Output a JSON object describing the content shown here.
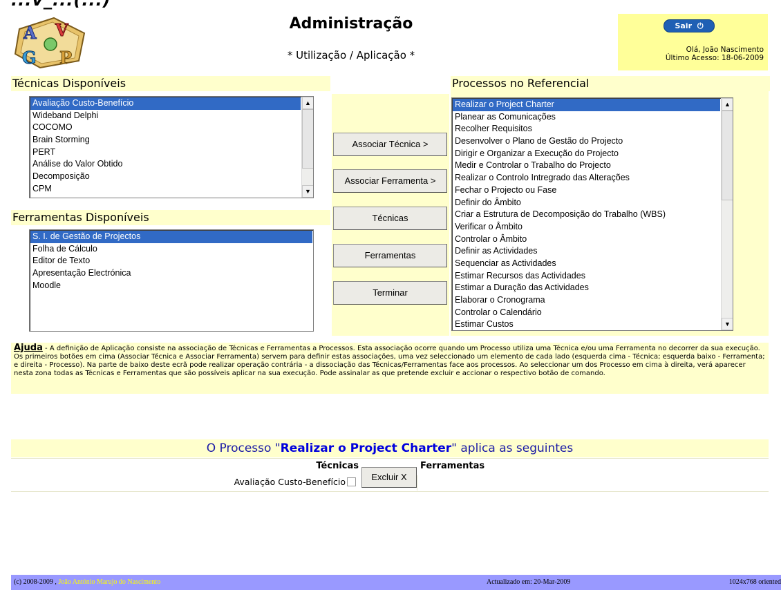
{
  "page": {
    "cut_heading": "...v_...(...)",
    "title": "Administração",
    "subtitle": "* Utilização / Aplicação *"
  },
  "user": {
    "logout_label": "Sair",
    "greeting": "Olá, João Nascimento",
    "last_access": "Último Acesso: 18-06-2009"
  },
  "techniques": {
    "heading": "Técnicas Disponíveis",
    "items": [
      "Avaliação Custo-Benefício",
      "Wideband Delphi",
      "COCOMO",
      "Brain Storming",
      "PERT",
      "Análise do Valor Obtido",
      "Decomposição",
      "CPM"
    ],
    "selected_index": 0
  },
  "tools": {
    "heading": "Ferramentas Disponíveis",
    "items": [
      "S. I. de Gestão de Projectos",
      "Folha de Cálculo",
      "Editor de Texto",
      "Apresentação Electrónica",
      "Moodle"
    ],
    "selected_index": 0
  },
  "actions": {
    "assoc_technique": "Associar Técnica >",
    "assoc_tool": "Associar Ferramenta >",
    "techniques": "Técnicas",
    "tools": "Ferramentas",
    "finish": "Terminar"
  },
  "processes": {
    "heading": "Processos no Referencial",
    "items": [
      "Realizar o Project Charter",
      "Planear as Comunicações",
      "Recolher Requisitos",
      "Desenvolver o Plano de Gestão do Projecto",
      "Dirigir e Organizar a Execução do Projecto",
      "Medir e Controlar o Trabalho do Projecto",
      "Realizar o Controlo Intregrado das Alterações",
      "Fechar o Projecto ou Fase",
      "Definir do Âmbito",
      "Criar a Estrutura de Decomposição do Trabalho (WBS)",
      "Verificar o Âmbito",
      "Controlar o Âmbito",
      "Definir as Actividades",
      "Sequenciar as Actividades",
      "Estimar Recursos das Actividades",
      "Estimar a Duração das Actividades",
      "Elaborar o Cronograma",
      "Controlar o Calendário",
      "Estimar Custos"
    ],
    "selected_index": 0
  },
  "help": {
    "label": "Ajuda",
    "text": " - A definição de Aplicação consiste na associação de Técnicas e Ferramentas a Processos. Esta associação ocorre quando um Processo utiliza uma Técnica e/ou uma Ferramenta no decorrer da sua execução. Os primeiros botões em cima (Associar Técnica e Associar Ferramenta) servem para definir estas associações, uma vez seleccionado um elemento de cada lado (esquerda cima - Técnica; esquerda baixo - Ferramenta; e direita - Processo). Na parte de baixo deste ecrã pode realizar operação contrária - a dissociação das Técnicas/Ferramentas face aos processos. Ao seleccionar um dos Processo em cima à direita, verá aparecer nesta zona todas as Técnicas e Ferramentas que são possíveis aplicar na sua execução. Pode assinalar as que pretende excluir e accionar o respectivo botão de comando."
  },
  "process_detail": {
    "prefix": "O Processo \"",
    "process_name": "Realizar o Project Charter",
    "suffix": "\" aplica as seguintes",
    "col_techniques": "Técnicas",
    "col_tools": "Ferramentas",
    "technique_rows": [
      "Avaliação Custo-Benefício"
    ],
    "exclude_label": "Excluir X"
  },
  "footer": {
    "copyright": "(c) 2008-2009 , ",
    "author": "João António Marujo do Nascimento",
    "updated": "Actualizado em: 20-Mar-2009",
    "resolution": "1024x768 oriented"
  }
}
